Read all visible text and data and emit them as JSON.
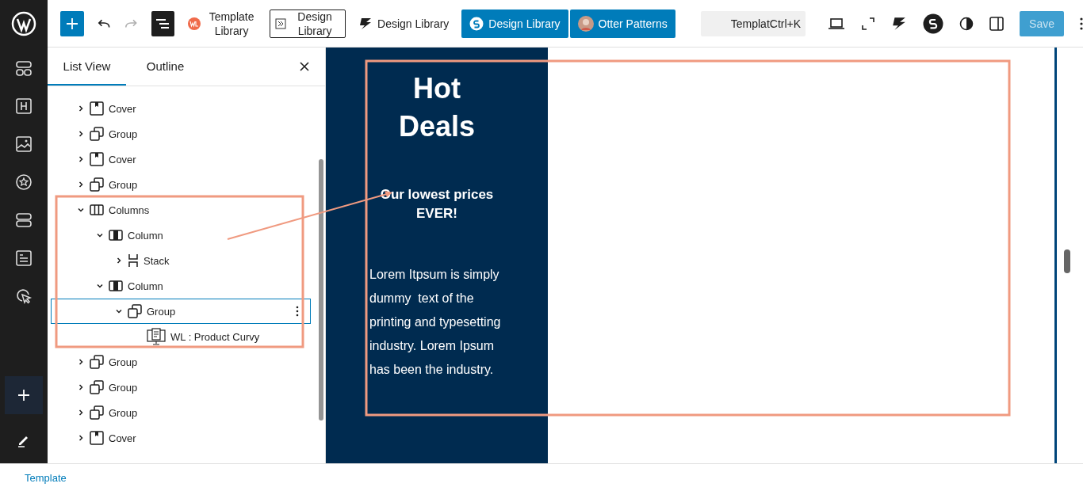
{
  "toolbar": {
    "list_view_on": true,
    "redo_disabled": true,
    "template_library": "Template Library",
    "design_library_boxed": "Design Library",
    "design_library_plain": "Design Library",
    "design_library_button": "Design Library",
    "otter_patterns": "Otter Patterns",
    "command": {
      "title": "Templat",
      "shortcut": "Ctrl+K"
    },
    "save": {
      "label": "Save",
      "disabled": true
    }
  },
  "panel": {
    "tabs": [
      {
        "label": "List View",
        "selected": true
      },
      {
        "label": "Outline",
        "selected": false
      }
    ],
    "tree": [
      {
        "label": "Cover",
        "kind": "cover",
        "expanded": false,
        "selected": false
      },
      {
        "label": "Group",
        "kind": "group",
        "expanded": false,
        "selected": false
      },
      {
        "label": "Cover",
        "kind": "cover",
        "expanded": false,
        "selected": false
      },
      {
        "label": "Group",
        "kind": "group",
        "expanded": false,
        "selected": false
      },
      {
        "label": "Columns",
        "kind": "columns",
        "expanded": true,
        "selected": false,
        "children": [
          {
            "label": "Column",
            "kind": "column",
            "expanded": true,
            "selected": false,
            "children": [
              {
                "label": "Stack",
                "kind": "stack",
                "expanded": false,
                "selected": false
              }
            ]
          },
          {
            "label": "Column",
            "kind": "column",
            "expanded": true,
            "selected": false,
            "children": [
              {
                "label": "Group",
                "kind": "group",
                "expanded": true,
                "selected": true,
                "children": [
                  {
                    "label": "WL : Product Curvy",
                    "kind": "pattern",
                    "selected": false
                  }
                ]
              }
            ]
          }
        ]
      },
      {
        "label": "Group",
        "kind": "group",
        "expanded": false,
        "selected": false
      },
      {
        "label": "Group",
        "kind": "group",
        "expanded": false,
        "selected": false
      },
      {
        "label": "Group",
        "kind": "group",
        "expanded": false,
        "selected": false
      },
      {
        "label": "Cover",
        "kind": "cover",
        "expanded": false,
        "selected": false
      }
    ]
  },
  "canvas": {
    "heading": "Hot Deals",
    "subheading": "Our lowest prices EVER!",
    "body": "Lorem Itpsum is simply dummy  text of the printing and typesetting industry. Lorem Ipsum has been the industry."
  },
  "footer": {
    "breadcrumb": "Template"
  }
}
